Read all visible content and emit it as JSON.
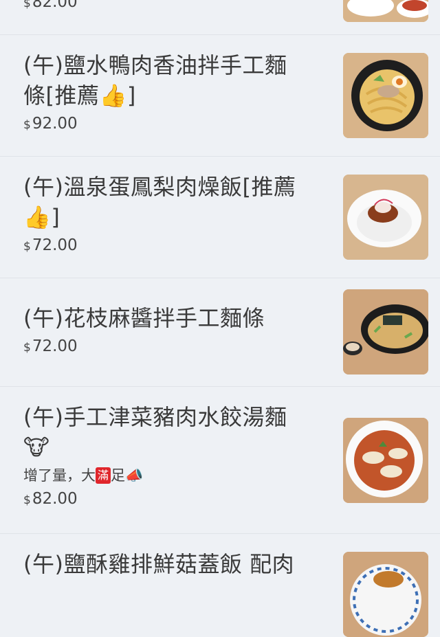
{
  "items": [
    {
      "name": "",
      "desc": "",
      "currency": "$",
      "price": "82.00",
      "image": "dish-thumbnail"
    },
    {
      "name": "(午)鹽水鴨肉香油拌手工麵條[推薦👍]",
      "desc": "",
      "currency": "$",
      "price": "92.00",
      "image": "duck-noodle-thumbnail"
    },
    {
      "name": "(午)溫泉蛋鳳梨肉燥飯[推薦👍]",
      "desc": "",
      "currency": "$",
      "price": "72.00",
      "image": "pork-rice-thumbnail"
    },
    {
      "name": "(午)花枝麻醬拌手工麵條",
      "desc": "",
      "currency": "$",
      "price": "72.00",
      "image": "sesame-noodle-thumbnail"
    },
    {
      "name": "(午)手工津菜豬肉水餃湯麵🐮",
      "desc_parts": [
        "增了量，大",
        "滿",
        "足📣"
      ],
      "currency": "$",
      "price": "82.00",
      "image": "dumpling-soup-thumbnail"
    },
    {
      "name": "(午)鹽酥雞排鮮菇蓋飯 配肉",
      "desc": "",
      "currency": "$",
      "price": "",
      "image": "chicken-rice-thumbnail"
    }
  ]
}
